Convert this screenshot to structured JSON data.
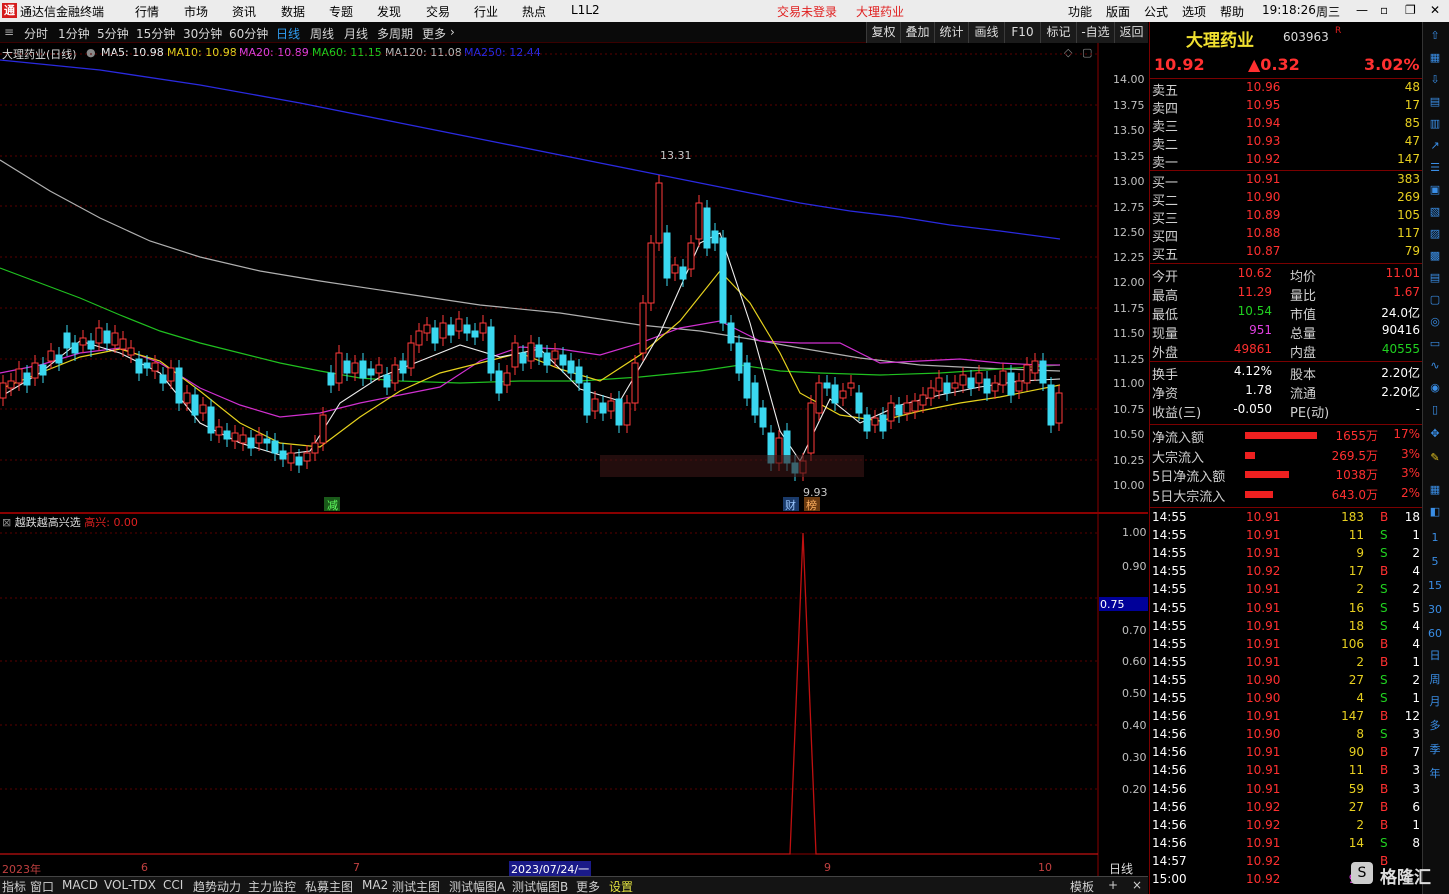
{
  "app": {
    "title": "通达信金融终端",
    "menu": [
      "行情",
      "市场",
      "资讯",
      "数据",
      "专题",
      "发现",
      "交易",
      "行业",
      "热点",
      "L1L2"
    ],
    "status_login": "交易未登录",
    "status_stock": "大理药业",
    "right_menu": [
      "功能",
      "版面",
      "公式",
      "选项",
      "帮助"
    ],
    "time": "19:18:26",
    "weekday": "周三"
  },
  "periods": [
    "分时",
    "1分钟",
    "5分钟",
    "15分钟",
    "30分钟",
    "60分钟",
    "日线",
    "周线",
    "月线",
    "多周期",
    "更多"
  ],
  "tools": [
    "复权",
    "叠加",
    "统计",
    "画线",
    "F10",
    "标记",
    "-自选",
    "返回"
  ],
  "legend": {
    "name": "大理药业(日线)",
    "ma5": "MA5: 10.98",
    "ma10": "MA10: 10.98",
    "ma20": "MA20: 10.89",
    "ma60": "MA60: 11.15",
    "ma120": "MA120: 11.08",
    "ma250": "MA250: 12.44"
  },
  "yaxis": [
    "14.00",
    "13.75",
    "13.50",
    "13.25",
    "13.00",
    "12.75",
    "12.50",
    "12.25",
    "12.00",
    "11.75",
    "11.50",
    "11.25",
    "11.00",
    "10.75",
    "10.50",
    "10.25",
    "10.00"
  ],
  "annot": {
    "high": "13.31",
    "low": "9.93",
    "jian": "减",
    "cai": "财",
    "bang": "榜"
  },
  "indicator": {
    "name": "越跌越高兴选",
    "param_label": "高兴:",
    "param_value": "0.00",
    "yaxis": [
      "1.00",
      "0.90",
      "0.70",
      "0.60",
      "0.50",
      "0.40",
      "0.30",
      "0.20"
    ],
    "marker": "0.75"
  },
  "xaxis": {
    "labels": [
      "2023年",
      "6",
      "7",
      "2023/07/24/一",
      "9",
      "10"
    ],
    "right": "日线"
  },
  "bottom_tabs": [
    "指标",
    "窗口",
    "MACD",
    "VOL-TDX",
    "CCI",
    "趋势动力",
    "主力监控",
    "私募主图",
    "MA2",
    "测试主图",
    "测试幅图A",
    "测试幅图B",
    "更多",
    "设置"
  ],
  "bottom_right": [
    "模板",
    "+",
    "×"
  ],
  "quote": {
    "name": "大理药业",
    "code": "603963",
    "flag": "R",
    "price": "10.92",
    "change": "▲0.32",
    "pct": "3.02%",
    "asks": [
      [
        "卖五",
        "10.96",
        "48"
      ],
      [
        "卖四",
        "10.95",
        "17"
      ],
      [
        "卖三",
        "10.94",
        "85"
      ],
      [
        "卖二",
        "10.93",
        "47"
      ],
      [
        "卖一",
        "10.92",
        "147"
      ]
    ],
    "bids": [
      [
        "买一",
        "10.91",
        "383"
      ],
      [
        "买二",
        "10.90",
        "269"
      ],
      [
        "买三",
        "10.89",
        "105"
      ],
      [
        "买四",
        "10.88",
        "117"
      ],
      [
        "买五",
        "10.87",
        "79"
      ]
    ],
    "stats": [
      [
        "今开",
        "10.62",
        "均价",
        "11.01"
      ],
      [
        "最高",
        "11.29",
        "量比",
        "1.67"
      ],
      [
        "最低",
        "10.54",
        "市值",
        "24.0亿"
      ],
      [
        "现量",
        "951",
        "总量",
        "90416"
      ],
      [
        "外盘",
        "49861",
        "内盘",
        "40555"
      ]
    ],
    "stats2": [
      [
        "换手",
        "4.12%",
        "股本",
        "2.20亿"
      ],
      [
        "净资",
        "1.78",
        "流通",
        "2.20亿"
      ],
      [
        "收益(三)",
        "-0.050",
        "PE(动)",
        "-"
      ]
    ],
    "flows": [
      [
        "净流入额",
        "1655万",
        "17%"
      ],
      [
        "大宗流入",
        "269.5万",
        "3%"
      ],
      [
        "5日净流入额",
        "1038万",
        "3%"
      ],
      [
        "5日大宗流入",
        "643.0万",
        "2%"
      ]
    ],
    "ticks": [
      [
        "14:55",
        "10.91",
        "183",
        "B",
        "18"
      ],
      [
        "14:55",
        "10.91",
        "11",
        "S",
        "1"
      ],
      [
        "14:55",
        "10.91",
        "9",
        "S",
        "2"
      ],
      [
        "14:55",
        "10.92",
        "17",
        "B",
        "4"
      ],
      [
        "14:55",
        "10.91",
        "2",
        "S",
        "2"
      ],
      [
        "14:55",
        "10.91",
        "16",
        "S",
        "5"
      ],
      [
        "14:55",
        "10.91",
        "18",
        "S",
        "4"
      ],
      [
        "14:55",
        "10.91",
        "106",
        "B",
        "4"
      ],
      [
        "14:55",
        "10.91",
        "2",
        "B",
        "1"
      ],
      [
        "14:55",
        "10.90",
        "27",
        "S",
        "2"
      ],
      [
        "14:55",
        "10.90",
        "4",
        "S",
        "1"
      ],
      [
        "14:56",
        "10.91",
        "147",
        "B",
        "12"
      ],
      [
        "14:56",
        "10.90",
        "8",
        "S",
        "3"
      ],
      [
        "14:56",
        "10.91",
        "90",
        "B",
        "7"
      ],
      [
        "14:56",
        "10.91",
        "11",
        "B",
        "3"
      ],
      [
        "14:56",
        "10.91",
        "59",
        "B",
        "3"
      ],
      [
        "14:56",
        "10.92",
        "27",
        "B",
        "6"
      ],
      [
        "14:56",
        "10.92",
        "2",
        "B",
        "1"
      ],
      [
        "14:56",
        "10.91",
        "14",
        "S",
        "8"
      ],
      [
        "14:57",
        "10.92",
        "",
        "B",
        ""
      ],
      [
        "15:00",
        "10.92",
        "95",
        "",
        ""
      ]
    ]
  },
  "side": [
    "1",
    "5",
    "15",
    "30",
    "60",
    "日",
    "周",
    "月",
    "多",
    "季",
    "年"
  ],
  "watermark": "格隆汇"
}
